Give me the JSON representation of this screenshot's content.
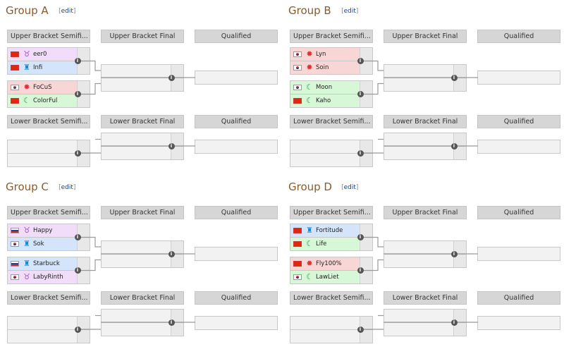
{
  "edit_label": "edit",
  "headers": {
    "ub_semi": "Upper Bracket Semifi...",
    "ub_final": "Upper Bracket Final",
    "lb_semi": "Lower Bracket Semifi...",
    "lb_final": "Lower Bracket Final",
    "qualified": "Qualified"
  },
  "race_colors": {
    "undead": "#a24fd0",
    "human": "#1a8ad0",
    "orc": "#e03030",
    "elf": "#1fa535"
  },
  "groups": [
    {
      "title": "Group A",
      "matches": [
        [
          {
            "name": "eer0",
            "flag": "cn",
            "race": "undead"
          },
          {
            "name": "Infi",
            "flag": "cn",
            "race": "human"
          }
        ],
        [
          {
            "name": "FoCuS",
            "flag": "kr",
            "race": "orc"
          },
          {
            "name": "ColorFul",
            "flag": "cn",
            "race": "elf"
          }
        ]
      ]
    },
    {
      "title": "Group B",
      "matches": [
        [
          {
            "name": "Lyn",
            "flag": "kr",
            "race": "orc"
          },
          {
            "name": "Soin",
            "flag": "kr",
            "race": "orc"
          }
        ],
        [
          {
            "name": "Moon",
            "flag": "kr",
            "race": "elf"
          },
          {
            "name": "Kaho",
            "flag": "cn",
            "race": "elf"
          }
        ]
      ]
    },
    {
      "title": "Group C",
      "matches": [
        [
          {
            "name": "Happy",
            "flag": "ru",
            "race": "undead"
          },
          {
            "name": "Sok",
            "flag": "kr",
            "race": "human"
          }
        ],
        [
          {
            "name": "Starbuck",
            "flag": "ru",
            "race": "human"
          },
          {
            "name": "LabyRinth",
            "flag": "kr",
            "race": "undead"
          }
        ]
      ]
    },
    {
      "title": "Group D",
      "matches": [
        [
          {
            "name": "Fortitude",
            "flag": "cn",
            "race": "human"
          },
          {
            "name": "Life",
            "flag": "cn",
            "race": "elf"
          }
        ],
        [
          {
            "name": "Fly100%",
            "flag": "cn",
            "race": "orc"
          },
          {
            "name": "LawLiet",
            "flag": "kr",
            "race": "elf"
          }
        ]
      ]
    }
  ]
}
